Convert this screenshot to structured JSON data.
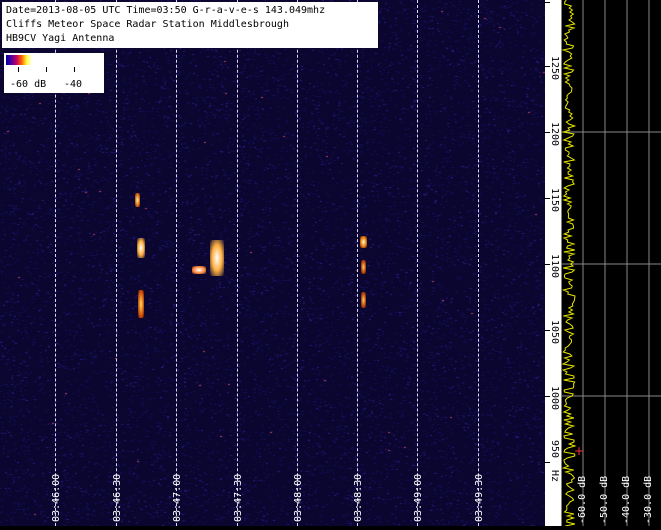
{
  "info": {
    "line1": "Date=2013-08-05 UTC Time=03:50  G-r-a-v-e-s 143.049mhz",
    "line2": "Cliffs Meteor Space Radar Station Middlesbrough",
    "line3": "HB9CV Yagi Antenna"
  },
  "legend": {
    "low": "-60 dB",
    "high": "-40"
  },
  "time_labels": [
    "03:46:00",
    "03:46:30",
    "03:47:00",
    "03:47:30",
    "03:48:00",
    "03:48:30",
    "03:49:00",
    "03:49:30"
  ],
  "freq_labels": [
    "1250",
    "1200",
    "1150",
    "1100",
    "1050",
    "1000",
    "950"
  ],
  "freq_unit": "Hz",
  "db_labels": [
    "-60.0 dB",
    "-50.0 dB",
    "-40.0 dB",
    "-30.0 dB"
  ],
  "colors": {
    "background": "#0a0630",
    "spectrum": "#e8e800",
    "grid": "#d8d8ff"
  }
}
